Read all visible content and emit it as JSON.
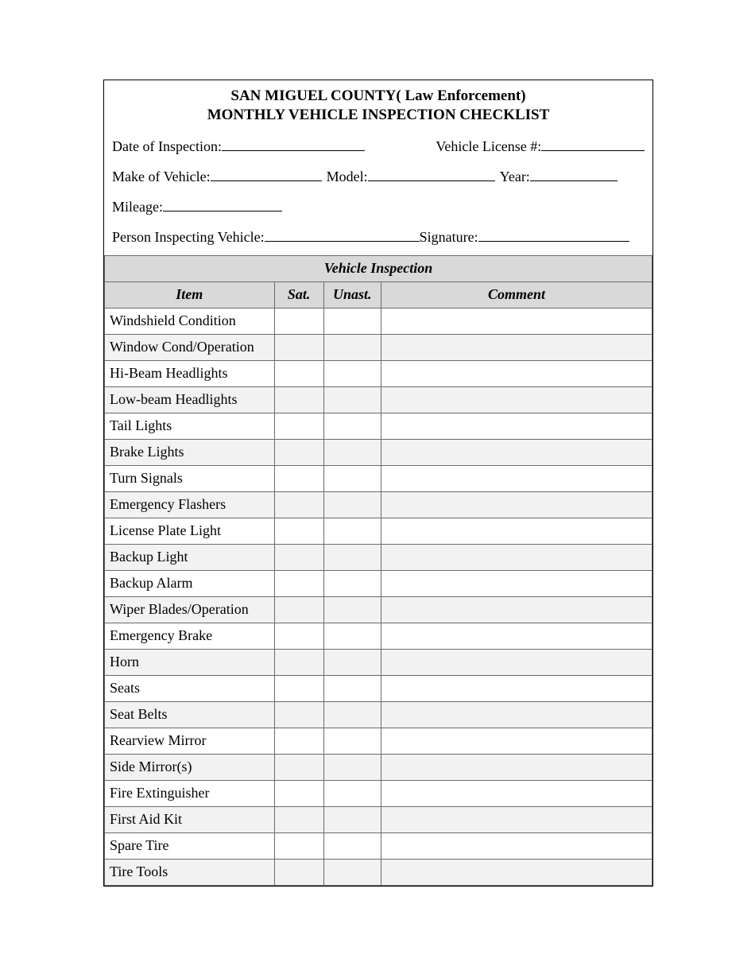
{
  "header": {
    "title1": "SAN MIGUEL COUNTY( Law Enforcement)",
    "title2": "MONTHLY VEHICLE INSPECTION CHECKLIST"
  },
  "fields": {
    "date_label": "Date of Inspection:",
    "license_label": "Vehicle License #:",
    "make_label": "Make of Vehicle:",
    "model_label": "Model:",
    "year_label": "Year:",
    "mileage_label": "Mileage:",
    "person_label": "Person Inspecting Vehicle:",
    "signature_label": "Signature:"
  },
  "table": {
    "section_title": "Vehicle Inspection",
    "columns": {
      "item": "Item",
      "sat": "Sat.",
      "unast": "Unast.",
      "comment": "Comment"
    },
    "rows": [
      {
        "item": "Windshield Condition",
        "sat": "",
        "unast": "",
        "comment": ""
      },
      {
        "item": "Window Cond/Operation",
        "sat": "",
        "unast": "",
        "comment": ""
      },
      {
        "item": "Hi-Beam Headlights",
        "sat": "",
        "unast": "",
        "comment": ""
      },
      {
        "item": "Low-beam Headlights",
        "sat": "",
        "unast": "",
        "comment": ""
      },
      {
        "item": "Tail Lights",
        "sat": "",
        "unast": "",
        "comment": ""
      },
      {
        "item": "Brake Lights",
        "sat": "",
        "unast": "",
        "comment": ""
      },
      {
        "item": "Turn Signals",
        "sat": "",
        "unast": "",
        "comment": ""
      },
      {
        "item": "Emergency Flashers",
        "sat": "",
        "unast": "",
        "comment": ""
      },
      {
        "item": "License Plate Light",
        "sat": "",
        "unast": "",
        "comment": ""
      },
      {
        "item": "Backup Light",
        "sat": "",
        "unast": "",
        "comment": ""
      },
      {
        "item": "Backup Alarm",
        "sat": "",
        "unast": "",
        "comment": ""
      },
      {
        "item": "Wiper Blades/Operation",
        "sat": "",
        "unast": "",
        "comment": ""
      },
      {
        "item": "Emergency Brake",
        "sat": "",
        "unast": "",
        "comment": ""
      },
      {
        "item": "Horn",
        "sat": "",
        "unast": "",
        "comment": ""
      },
      {
        "item": "Seats",
        "sat": "",
        "unast": "",
        "comment": ""
      },
      {
        "item": "Seat Belts",
        "sat": "",
        "unast": "",
        "comment": ""
      },
      {
        "item": "Rearview Mirror",
        "sat": "",
        "unast": "",
        "comment": ""
      },
      {
        "item": "Side Mirror(s)",
        "sat": "",
        "unast": "",
        "comment": ""
      },
      {
        "item": "Fire Extinguisher",
        "sat": "",
        "unast": "",
        "comment": ""
      },
      {
        "item": "First Aid Kit",
        "sat": "",
        "unast": "",
        "comment": ""
      },
      {
        "item": "Spare Tire",
        "sat": "",
        "unast": "",
        "comment": ""
      },
      {
        "item": "Tire Tools",
        "sat": "",
        "unast": "",
        "comment": ""
      }
    ]
  }
}
